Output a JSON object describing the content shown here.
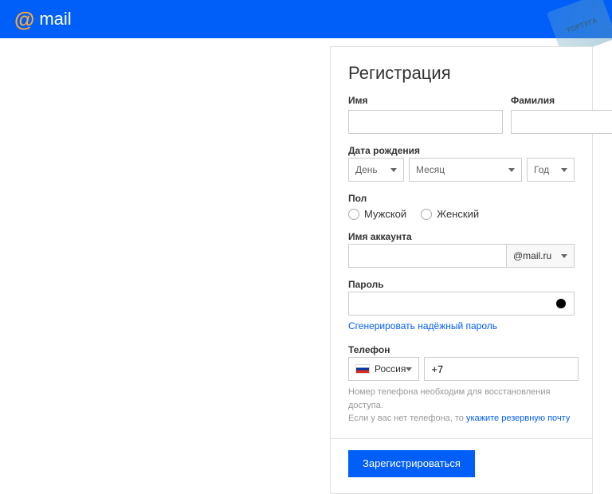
{
  "header": {
    "logo_text": "mail"
  },
  "watermark": "ТОРТУГА",
  "form": {
    "title": "Регистрация",
    "firstname_label": "Имя",
    "lastname_label": "Фамилия",
    "dob_label": "Дата рождения",
    "dob_day": "День",
    "dob_month": "Месяц",
    "dob_year": "Год",
    "gender_label": "Пол",
    "gender_male": "Мужской",
    "gender_female": "Женский",
    "account_label": "Имя аккаунта",
    "domain": "@mail.ru",
    "password_label": "Пароль",
    "generate_link": "Сгенерировать надёжный пароль",
    "phone_label": "Телефон",
    "country": "Россия",
    "phone_prefix": "+7",
    "hint1": "Номер телефона необходим для восстановления доступа.",
    "hint2a": "Если у вас нет телефона, то ",
    "hint2b": "укажите резервную почту",
    "submit": "Зарегистрироваться"
  }
}
